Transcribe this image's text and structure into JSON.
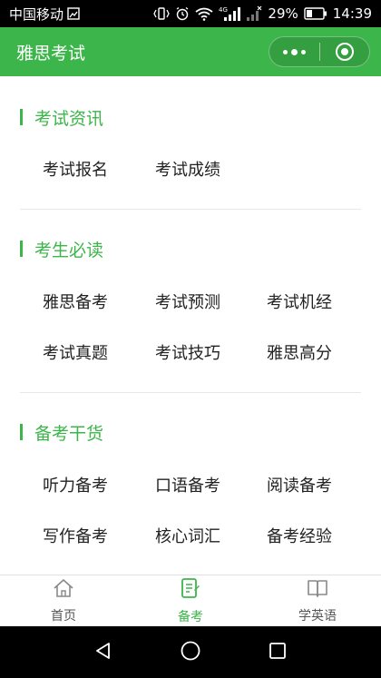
{
  "status_bar": {
    "carrier": "中国移动",
    "network_tag": "4G",
    "battery": "29%",
    "time": "14:39"
  },
  "header": {
    "title": "雅思考试"
  },
  "sections": [
    {
      "title": "考试资讯",
      "items": [
        "考试报名",
        "考试成绩"
      ]
    },
    {
      "title": "考生必读",
      "items": [
        "雅思备考",
        "考试预测",
        "考试机经",
        "考试真题",
        "考试技巧",
        "雅思高分"
      ]
    },
    {
      "title": "备考干货",
      "items": [
        "听力备考",
        "口语备考",
        "阅读备考",
        "写作备考",
        "核心词汇",
        "备考经验"
      ]
    }
  ],
  "tabbar": {
    "active": 1,
    "items": [
      {
        "label": "首页",
        "icon": "home-icon"
      },
      {
        "label": "备考",
        "icon": "notes-icon"
      },
      {
        "label": "学英语",
        "icon": "book-icon"
      }
    ]
  },
  "colors": {
    "brand": "#3cb54a",
    "text": "#222222"
  }
}
